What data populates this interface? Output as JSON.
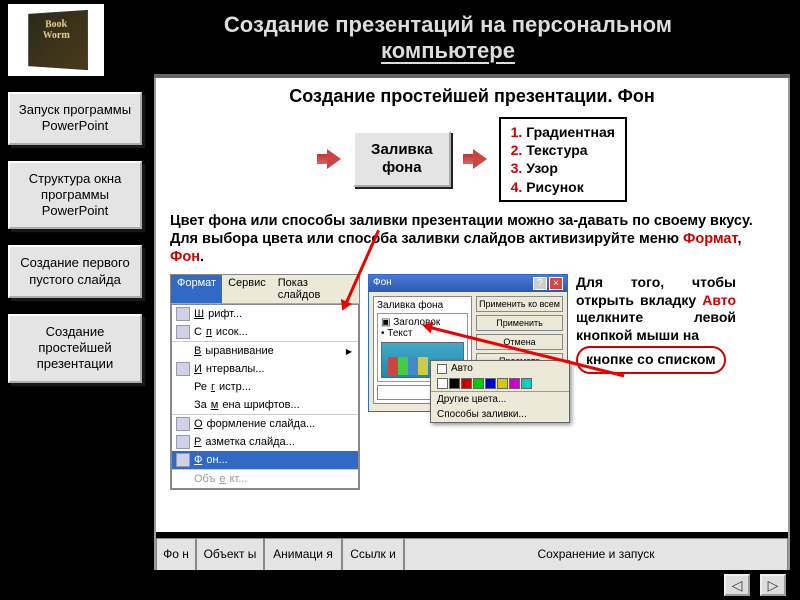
{
  "header": {
    "title_line1": "Создание презентаций на персональном",
    "title_line2": "компьютере"
  },
  "sidebar": {
    "items": [
      {
        "label": "Запуск программы PowerPoint"
      },
      {
        "label": "Структура окна программы PowerPoint"
      },
      {
        "label": "Создание первого пустого слайда"
      },
      {
        "label": "Создание простейшей презентации"
      }
    ]
  },
  "main": {
    "subtitle": "Создание простейшей презентации. Фон",
    "fill_box": "Заливка\nфона",
    "options": [
      {
        "n": "1.",
        "t": "Градиентная"
      },
      {
        "n": "2.",
        "t": "Текстура"
      },
      {
        "n": "3.",
        "t": "Узор"
      },
      {
        "n": "4.",
        "t": "Рисунок"
      }
    ],
    "desc_pre": "Цвет фона или способы заливки презентации можно за-давать по своему вкусу. Для выбора цвета или способа заливки слайдов активизируйте меню ",
    "desc_hl1": "Формат",
    "desc_sep": ", ",
    "desc_hl2": "Фон",
    "desc_end": ".",
    "menu": {
      "bar": [
        "Формат",
        "Сервис",
        "Показ слайдов"
      ],
      "items": [
        "Шрифт...",
        "Список...",
        "Выравнивание",
        "Интервалы...",
        "Регистр...",
        "Замена шрифтов...",
        "Оформление слайда...",
        "Разметка слайда...",
        "Фон...",
        "Объект..."
      ]
    },
    "dialog": {
      "title": "Фон",
      "group_label": "Заливка фона",
      "chk1": "Заголовок",
      "chk2": "Текст",
      "buttons": [
        "Применить ко всем",
        "Применить",
        "Отмена",
        "Просмотр"
      ]
    },
    "popup": {
      "auto": "Авто",
      "more": "Другие цвета...",
      "fill": "Способы заливки..."
    },
    "side_text_pre": "Для того, чтобы открыть вкладку ",
    "side_hl": "Авто",
    "side_text_post": " щелкните левой кнопкой мыши на",
    "callout": "кнопке со списком"
  },
  "tabs": [
    "Фо н",
    "Объект ы",
    "Анимаци я",
    "Ссылк и",
    "Сохранение и запуск"
  ],
  "nav": {
    "prev": "◁",
    "next": "▷"
  }
}
